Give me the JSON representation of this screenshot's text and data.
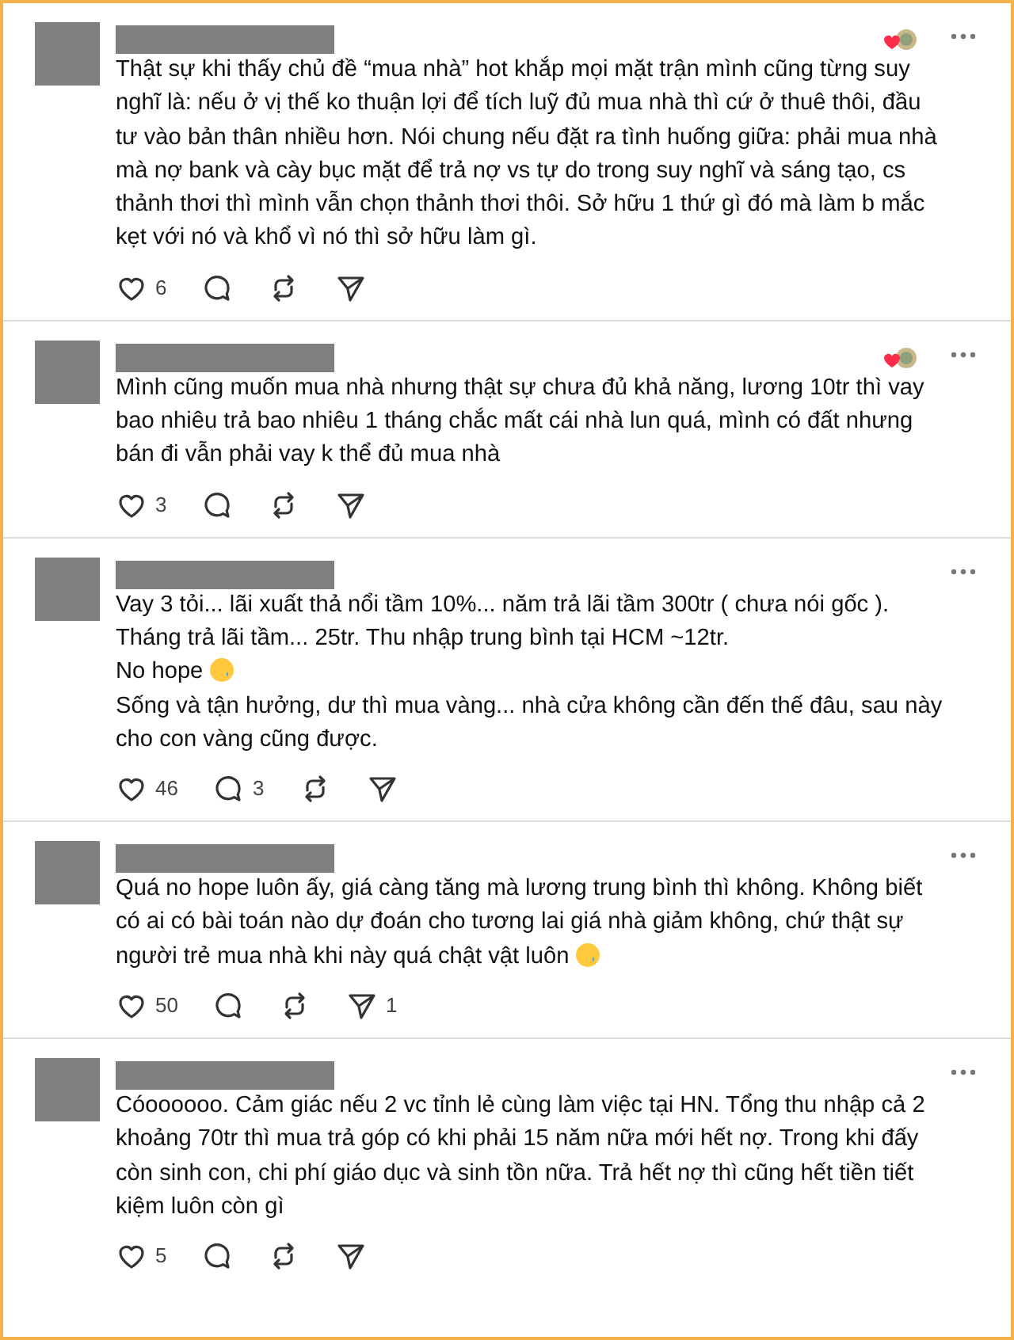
{
  "posts": [
    {
      "author_liked": true,
      "paragraphs": [
        {
          "text": "Thật sự khi thấy chủ đề “mua nhà” hot khắp mọi mặt trận mình cũng từng suy nghĩ là: nếu ở vị thế ko thuận lợi để tích luỹ đủ mua nhà thì cứ ở thuê thôi, đầu tư vào bản thân nhiều hơn. Nói chung nếu đặt ra tình huống giữa: phải mua nhà mà nợ bank và cày bục mặt để trả nợ vs tự do trong suy nghĩ và sáng tạo, cs thảnh thơi thì mình vẫn chọn thảnh thơi thôi. Sở hữu 1 thứ gì đó mà làm b mắc kẹt với nó và khổ vì nó thì sở hữu làm gì.",
          "emoji": false
        }
      ],
      "likes": "6"
    },
    {
      "author_liked": true,
      "paragraphs": [
        {
          "text": "Mình cũng muốn mua nhà nhưng thật sự chưa đủ khả năng, lương 10tr thì vay bao nhiêu trả bao nhiêu 1 tháng chắc mất cái nhà lun quá, mình có đất nhưng bán đi vẫn phải vay k thể đủ mua nhà",
          "emoji": false
        }
      ],
      "likes": "3"
    },
    {
      "author_liked": false,
      "paragraphs": [
        {
          "text": "Vay 3 tỏi... lãi xuất thả nổi tầm 10%... năm trả lãi tầm 300tr ( chưa nói gốc ).",
          "emoji": false
        },
        {
          "text": "Tháng trả lãi tầm... 25tr. Thu nhập trung bình tại HCM ~12tr.",
          "emoji": false
        },
        {
          "text": "No hope",
          "emoji": true
        },
        {
          "text": "Sống và tận hưởng, dư thì mua vàng... nhà cửa không cần đến thế đâu, sau này cho con vàng cũng được.",
          "emoji": false
        }
      ],
      "likes": "46",
      "replies": "3"
    },
    {
      "author_liked": false,
      "paragraphs": [
        {
          "text": "Quá no hope luôn ấy, giá càng tăng mà lương trung bình thì không. Không biết có ai có bài toán nào dự đoán cho tương lai giá nhà giảm không, chứ thật sự người trẻ mua nhà khi này quá chật vật luôn",
          "emoji": true
        }
      ],
      "likes": "50",
      "shares": "1"
    },
    {
      "author_liked": false,
      "paragraphs": [
        {
          "text": "Cóoooooo. Cảm giác nếu 2 vc tỉnh lẻ cùng làm việc tại HN. Tổng thu nhập cả 2 khoảng 70tr thì mua trả góp có khi phải 15 năm nữa mới hết nợ. Trong khi đấy còn sinh con, chi phí giáo dục và sinh tồn nữa. Trả hết nợ thì cũng hết tiền tiết kiệm luôn còn gì",
          "emoji": false
        }
      ],
      "likes": "5"
    }
  ]
}
